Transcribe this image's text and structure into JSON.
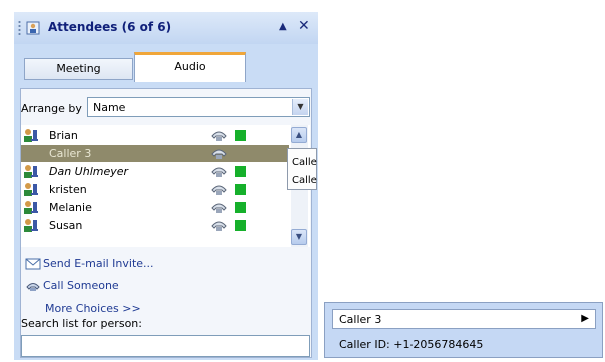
{
  "pane": {
    "title": "Attendees (6 of 6)",
    "collapse_glyph": "▲",
    "close_glyph": "✕"
  },
  "tabs": [
    {
      "label": "Meeting",
      "active": false
    },
    {
      "label": "Audio",
      "active": true
    }
  ],
  "arrange": {
    "label": "Arrange by",
    "value": "Name"
  },
  "attendees": [
    {
      "name": "Brian",
      "selected": false,
      "italic": false,
      "status_color": "#16b02b"
    },
    {
      "name": "Caller 3",
      "selected": true,
      "italic": false,
      "status_color": ""
    },
    {
      "name": "Dan Uhlmeyer",
      "selected": false,
      "italic": true,
      "status_color": "#16b02b"
    },
    {
      "name": "kristen",
      "selected": false,
      "italic": false,
      "status_color": "#16b02b"
    },
    {
      "name": "Melanie",
      "selected": false,
      "italic": false,
      "status_color": "#16b02b"
    },
    {
      "name": "Susan",
      "selected": false,
      "italic": false,
      "status_color": "#16b02b"
    }
  ],
  "actions": {
    "send_invite": "Send E-mail Invite...",
    "call_someone": "Call Someone",
    "more_choices": "More Choices >>"
  },
  "search": {
    "label": "Search list for person:",
    "value": ""
  },
  "submenu": [
    "Calle",
    "Calle"
  ],
  "popup": {
    "name": "Caller 3",
    "caller_id": "Caller ID: +1-2056784645"
  }
}
